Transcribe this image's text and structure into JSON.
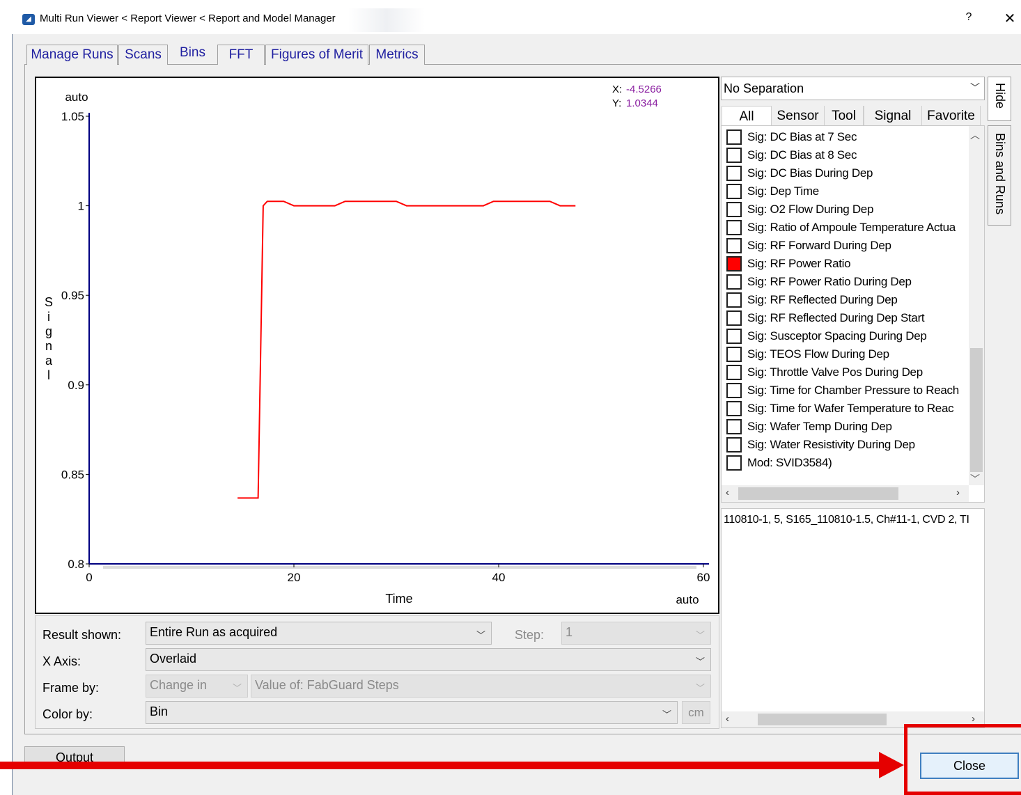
{
  "window": {
    "title": "Multi Run Viewer < Report Viewer < Report and Model Manager",
    "help_label": "?",
    "close_label": "✕"
  },
  "tabs": [
    {
      "label": "Manage Runs",
      "active": false
    },
    {
      "label": "Scans",
      "active": false
    },
    {
      "label": "Bins",
      "active": true
    },
    {
      "label": "FFT",
      "active": false
    },
    {
      "label": "Figures of Merit",
      "active": false
    },
    {
      "label": "Metrics",
      "active": false
    }
  ],
  "chart_data": {
    "type": "line",
    "xlabel": "Time",
    "ylabel": "Signal",
    "x_scale_label": "auto",
    "y_scale_label": "auto",
    "xlim": [
      0,
      60
    ],
    "ylim": [
      0.8,
      1.05
    ],
    "x_ticks": [
      "0",
      "20",
      "40",
      "60"
    ],
    "y_ticks": [
      "1.05",
      "1",
      "0.95",
      "0.9",
      "0.85",
      "0.8"
    ],
    "cursor": {
      "x_label": "X:",
      "x_value": "-4.5266",
      "y_label": "Y:",
      "y_value": "1.0344"
    },
    "series": [
      {
        "color": "#ff0000",
        "points": [
          [
            14.5,
            0.8368
          ],
          [
            16.5,
            0.8368
          ],
          [
            17.0,
            1.0
          ],
          [
            17.4,
            1.0025
          ],
          [
            19.0,
            1.0025
          ],
          [
            20.0,
            1.0
          ],
          [
            24.0,
            1.0
          ],
          [
            25.0,
            1.0025
          ],
          [
            30.0,
            1.0025
          ],
          [
            31.0,
            1.0
          ],
          [
            38.5,
            1.0
          ],
          [
            39.5,
            1.0025
          ],
          [
            45.0,
            1.0025
          ],
          [
            46.0,
            1.0
          ],
          [
            47.5,
            1.0
          ]
        ]
      }
    ],
    "grid": false
  },
  "right_panel": {
    "separation": "No Separation",
    "filter_tabs": [
      "All",
      "Sensor",
      "Tool",
      "Signal",
      "Favorite"
    ],
    "items": [
      {
        "label": "Sig: DC Bias at 7 Sec",
        "checked": false
      },
      {
        "label": "Sig: DC Bias at 8 Sec",
        "checked": false
      },
      {
        "label": "Sig: DC Bias During Dep",
        "checked": false
      },
      {
        "label": "Sig: Dep Time",
        "checked": false
      },
      {
        "label": "Sig: O2 Flow During Dep",
        "checked": false
      },
      {
        "label": "Sig: Ratio of Ampoule Temperature Actua",
        "checked": false
      },
      {
        "label": "Sig: RF Forward During Dep",
        "checked": false
      },
      {
        "label": "Sig: RF Power Ratio",
        "checked": true
      },
      {
        "label": "Sig: RF Power Ratio During Dep",
        "checked": false
      },
      {
        "label": "Sig: RF Reflected During Dep",
        "checked": false
      },
      {
        "label": "Sig: RF Reflected During Dep Start",
        "checked": false
      },
      {
        "label": "Sig: Susceptor Spacing During Dep",
        "checked": false
      },
      {
        "label": "Sig: TEOS Flow During Dep",
        "checked": false
      },
      {
        "label": "Sig: Throttle Valve Pos During Dep",
        "checked": false
      },
      {
        "label": "Sig: Time for Chamber Pressure to Reach",
        "checked": false
      },
      {
        "label": "Sig: Time for Wafer Temperature to Reac",
        "checked": false
      },
      {
        "label": "Sig: Wafer Temp During Dep",
        "checked": false
      },
      {
        "label": "Sig: Water Resistivity During Dep",
        "checked": false
      },
      {
        "label": "Mod: SVID3584)",
        "checked": false
      }
    ],
    "run_text": "110810-1, 5, S165_110810-1.5, Ch#11-1, CVD 2, TI",
    "side_hide": "Hide",
    "side_bins": "Bins and Runs",
    "checked_color": "#ff0000"
  },
  "controls": {
    "result_label": "Result shown:",
    "result_value": "Entire Run as acquired",
    "step_label": "Step:",
    "step_value": "1",
    "xaxis_label": "X Axis:",
    "xaxis_value": "Overlaid",
    "frame_label": "Frame by:",
    "frame_mode": "Change in",
    "frame_value": "Value of: FabGuard Steps",
    "color_label": "Color by:",
    "color_value": "Bin",
    "cm_label": "cm"
  },
  "buttons": {
    "output": "Output",
    "close": "Close"
  }
}
